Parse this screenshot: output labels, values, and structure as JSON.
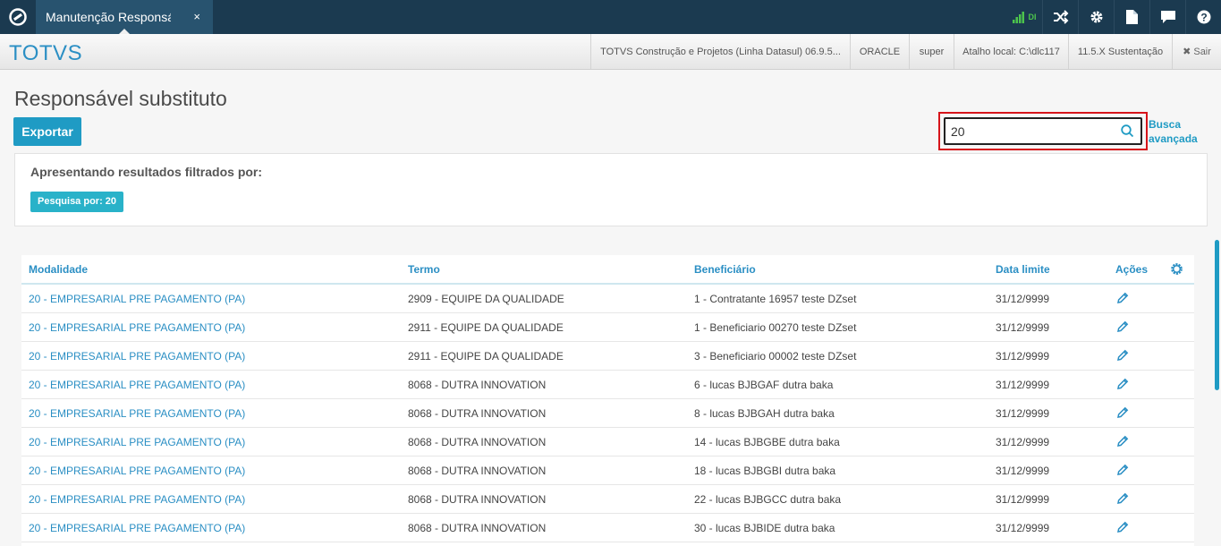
{
  "topbar": {
    "tab_label": "Manutenção Responsável substituto",
    "tab_close": "×",
    "signal_label": "DI",
    "icons": [
      "shuffle-icon",
      "gear-icon",
      "document-icon",
      "chat-icon",
      "help-icon"
    ]
  },
  "subheader": {
    "brand": "TOTVS",
    "product": "TOTVS Construção e Projetos (Linha Datasul) 06.9.5...",
    "database": "ORACLE",
    "user": "super",
    "shortcut": "Atalho local: C:\\dlc117",
    "version": "11.5.X Sustentação",
    "logout": "✖ Sair"
  },
  "page": {
    "title": "Responsável substituto",
    "export_label": "Exportar",
    "search_value": "20",
    "advanced_search_line1": "Busca",
    "advanced_search_line2": "avançada"
  },
  "filter": {
    "title": "Apresentando resultados filtrados por:",
    "chip": "Pesquisa por: 20"
  },
  "table": {
    "headers": {
      "modalidade": "Modalidade",
      "termo": "Termo",
      "beneficiario": "Beneficiário",
      "data_limite": "Data limite",
      "acoes": "Ações"
    },
    "rows": [
      {
        "modalidade": "20 - EMPRESARIAL PRE PAGAMENTO (PA)",
        "termo": "2909 - EQUIPE DA QUALIDADE",
        "beneficiario": "1 - Contratante 16957 teste DZset",
        "data_limite": "31/12/9999"
      },
      {
        "modalidade": "20 - EMPRESARIAL PRE PAGAMENTO (PA)",
        "termo": "2911 - EQUIPE DA QUALIDADE",
        "beneficiario": "1 - Beneficiario 00270 teste DZset",
        "data_limite": "31/12/9999"
      },
      {
        "modalidade": "20 - EMPRESARIAL PRE PAGAMENTO (PA)",
        "termo": "2911 - EQUIPE DA QUALIDADE",
        "beneficiario": "3 - Beneficiario 00002 teste DZset",
        "data_limite": "31/12/9999"
      },
      {
        "modalidade": "20 - EMPRESARIAL PRE PAGAMENTO (PA)",
        "termo": "8068 - DUTRA INNOVATION",
        "beneficiario": "6 - lucas BJBGAF dutra baka",
        "data_limite": "31/12/9999"
      },
      {
        "modalidade": "20 - EMPRESARIAL PRE PAGAMENTO (PA)",
        "termo": "8068 - DUTRA INNOVATION",
        "beneficiario": "8 - lucas BJBGAH dutra baka",
        "data_limite": "31/12/9999"
      },
      {
        "modalidade": "20 - EMPRESARIAL PRE PAGAMENTO (PA)",
        "termo": "8068 - DUTRA INNOVATION",
        "beneficiario": "14 - lucas BJBGBE dutra baka",
        "data_limite": "31/12/9999"
      },
      {
        "modalidade": "20 - EMPRESARIAL PRE PAGAMENTO (PA)",
        "termo": "8068 - DUTRA INNOVATION",
        "beneficiario": "18 - lucas BJBGBI dutra baka",
        "data_limite": "31/12/9999"
      },
      {
        "modalidade": "20 - EMPRESARIAL PRE PAGAMENTO (PA)",
        "termo": "8068 - DUTRA INNOVATION",
        "beneficiario": "22 - lucas BJBGCC dutra baka",
        "data_limite": "31/12/9999"
      },
      {
        "modalidade": "20 - EMPRESARIAL PRE PAGAMENTO (PA)",
        "termo": "8068 - DUTRA INNOVATION",
        "beneficiario": "30 - lucas BJBIDE dutra baka",
        "data_limite": "31/12/9999"
      }
    ]
  },
  "colors": {
    "topbar": "#1b3a50",
    "accent": "#1f9bc4",
    "chip": "#29b2c9",
    "highlight": "#d6141a",
    "signal": "#4cc44c"
  }
}
